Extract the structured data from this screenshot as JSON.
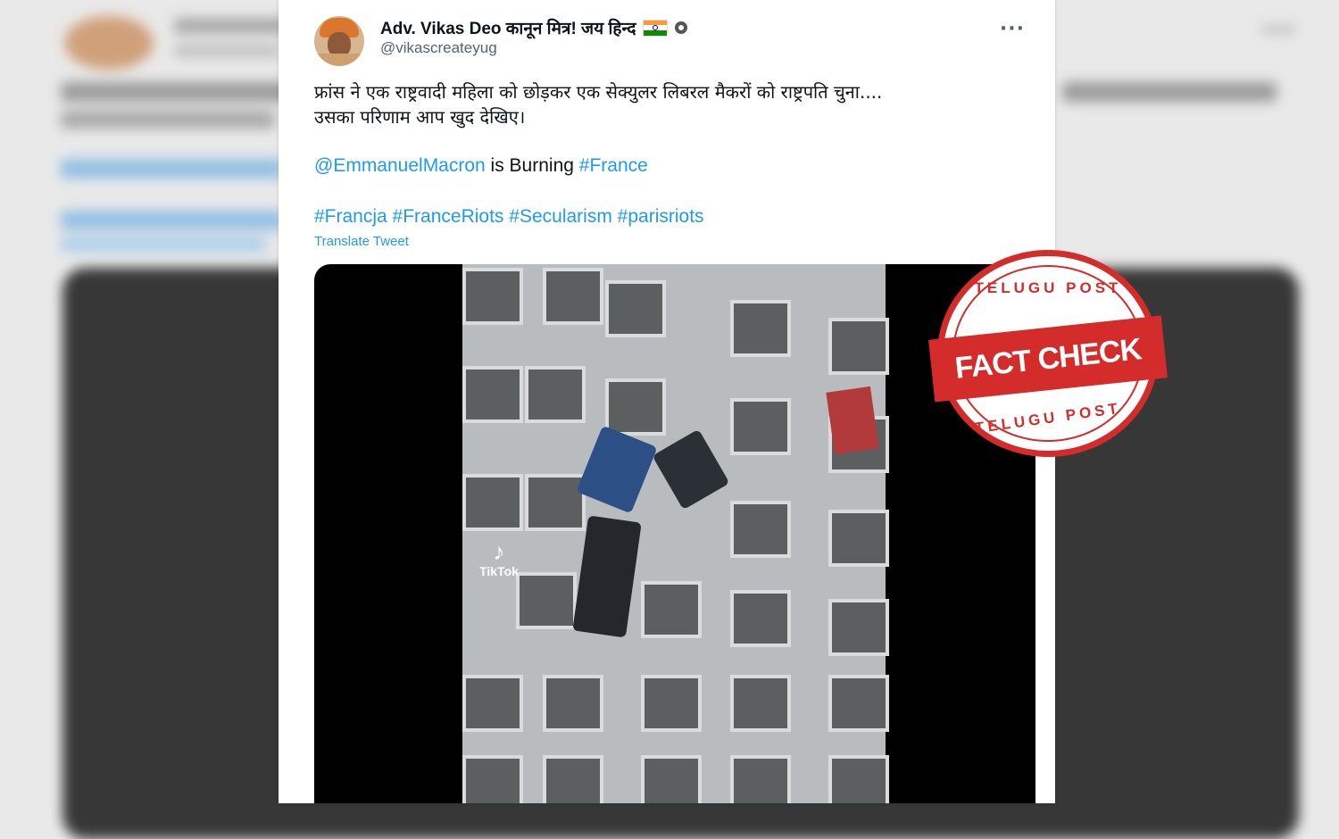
{
  "tweet": {
    "author_name": "Adv. Vikas Deo कानून मित्र! जय हिन्द",
    "handle": "@vikascreateyug",
    "more_label": "···",
    "text_line1": "फ्रांस ने एक राष्ट्रवादी महिला को छोड़कर एक सेक्युलर लिबरल मैकरों को राष्ट्रपति चुना....",
    "text_line2": "उसका परिणाम आप खुद देखिए।",
    "mention": "@EmmanuelMacron",
    "mention_suffix": " is Burning ",
    "hashtag_france": "#France",
    "hashtags": [
      "#Francja",
      "#FranceRiots",
      "#Secularism",
      "#parisriots"
    ],
    "translate_label": "Translate Tweet"
  },
  "media": {
    "watermark": "TikTok"
  },
  "stamp": {
    "top_text": "TELUGU POST",
    "center_text": "FACT CHECK",
    "bottom_text": "TELUGU POST",
    "color": "#d42b2b"
  },
  "colors": {
    "link": "#1d9bf0",
    "text": "#0f1419",
    "muted": "#536471"
  }
}
